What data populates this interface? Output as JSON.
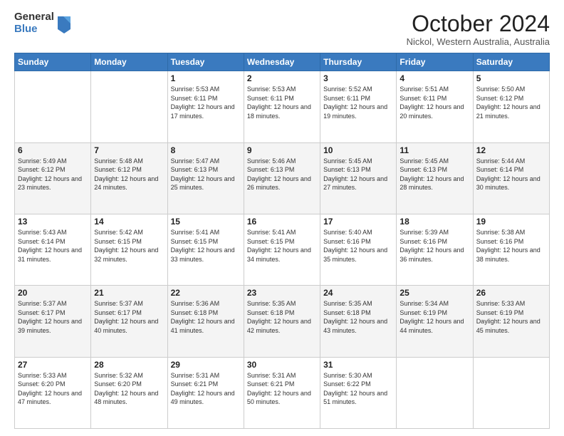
{
  "logo": {
    "general": "General",
    "blue": "Blue"
  },
  "header": {
    "month": "October 2024",
    "location": "Nickol, Western Australia, Australia"
  },
  "weekdays": [
    "Sunday",
    "Monday",
    "Tuesday",
    "Wednesday",
    "Thursday",
    "Friday",
    "Saturday"
  ],
  "weeks": [
    [
      {
        "day": "",
        "info": ""
      },
      {
        "day": "",
        "info": ""
      },
      {
        "day": "1",
        "info": "Sunrise: 5:53 AM\nSunset: 6:11 PM\nDaylight: 12 hours and 17 minutes."
      },
      {
        "day": "2",
        "info": "Sunrise: 5:53 AM\nSunset: 6:11 PM\nDaylight: 12 hours and 18 minutes."
      },
      {
        "day": "3",
        "info": "Sunrise: 5:52 AM\nSunset: 6:11 PM\nDaylight: 12 hours and 19 minutes."
      },
      {
        "day": "4",
        "info": "Sunrise: 5:51 AM\nSunset: 6:11 PM\nDaylight: 12 hours and 20 minutes."
      },
      {
        "day": "5",
        "info": "Sunrise: 5:50 AM\nSunset: 6:12 PM\nDaylight: 12 hours and 21 minutes."
      }
    ],
    [
      {
        "day": "6",
        "info": "Sunrise: 5:49 AM\nSunset: 6:12 PM\nDaylight: 12 hours and 23 minutes."
      },
      {
        "day": "7",
        "info": "Sunrise: 5:48 AM\nSunset: 6:12 PM\nDaylight: 12 hours and 24 minutes."
      },
      {
        "day": "8",
        "info": "Sunrise: 5:47 AM\nSunset: 6:13 PM\nDaylight: 12 hours and 25 minutes."
      },
      {
        "day": "9",
        "info": "Sunrise: 5:46 AM\nSunset: 6:13 PM\nDaylight: 12 hours and 26 minutes."
      },
      {
        "day": "10",
        "info": "Sunrise: 5:45 AM\nSunset: 6:13 PM\nDaylight: 12 hours and 27 minutes."
      },
      {
        "day": "11",
        "info": "Sunrise: 5:45 AM\nSunset: 6:13 PM\nDaylight: 12 hours and 28 minutes."
      },
      {
        "day": "12",
        "info": "Sunrise: 5:44 AM\nSunset: 6:14 PM\nDaylight: 12 hours and 30 minutes."
      }
    ],
    [
      {
        "day": "13",
        "info": "Sunrise: 5:43 AM\nSunset: 6:14 PM\nDaylight: 12 hours and 31 minutes."
      },
      {
        "day": "14",
        "info": "Sunrise: 5:42 AM\nSunset: 6:15 PM\nDaylight: 12 hours and 32 minutes."
      },
      {
        "day": "15",
        "info": "Sunrise: 5:41 AM\nSunset: 6:15 PM\nDaylight: 12 hours and 33 minutes."
      },
      {
        "day": "16",
        "info": "Sunrise: 5:41 AM\nSunset: 6:15 PM\nDaylight: 12 hours and 34 minutes."
      },
      {
        "day": "17",
        "info": "Sunrise: 5:40 AM\nSunset: 6:16 PM\nDaylight: 12 hours and 35 minutes."
      },
      {
        "day": "18",
        "info": "Sunrise: 5:39 AM\nSunset: 6:16 PM\nDaylight: 12 hours and 36 minutes."
      },
      {
        "day": "19",
        "info": "Sunrise: 5:38 AM\nSunset: 6:16 PM\nDaylight: 12 hours and 38 minutes."
      }
    ],
    [
      {
        "day": "20",
        "info": "Sunrise: 5:37 AM\nSunset: 6:17 PM\nDaylight: 12 hours and 39 minutes."
      },
      {
        "day": "21",
        "info": "Sunrise: 5:37 AM\nSunset: 6:17 PM\nDaylight: 12 hours and 40 minutes."
      },
      {
        "day": "22",
        "info": "Sunrise: 5:36 AM\nSunset: 6:18 PM\nDaylight: 12 hours and 41 minutes."
      },
      {
        "day": "23",
        "info": "Sunrise: 5:35 AM\nSunset: 6:18 PM\nDaylight: 12 hours and 42 minutes."
      },
      {
        "day": "24",
        "info": "Sunrise: 5:35 AM\nSunset: 6:18 PM\nDaylight: 12 hours and 43 minutes."
      },
      {
        "day": "25",
        "info": "Sunrise: 5:34 AM\nSunset: 6:19 PM\nDaylight: 12 hours and 44 minutes."
      },
      {
        "day": "26",
        "info": "Sunrise: 5:33 AM\nSunset: 6:19 PM\nDaylight: 12 hours and 45 minutes."
      }
    ],
    [
      {
        "day": "27",
        "info": "Sunrise: 5:33 AM\nSunset: 6:20 PM\nDaylight: 12 hours and 47 minutes."
      },
      {
        "day": "28",
        "info": "Sunrise: 5:32 AM\nSunset: 6:20 PM\nDaylight: 12 hours and 48 minutes."
      },
      {
        "day": "29",
        "info": "Sunrise: 5:31 AM\nSunset: 6:21 PM\nDaylight: 12 hours and 49 minutes."
      },
      {
        "day": "30",
        "info": "Sunrise: 5:31 AM\nSunset: 6:21 PM\nDaylight: 12 hours and 50 minutes."
      },
      {
        "day": "31",
        "info": "Sunrise: 5:30 AM\nSunset: 6:22 PM\nDaylight: 12 hours and 51 minutes."
      },
      {
        "day": "",
        "info": ""
      },
      {
        "day": "",
        "info": ""
      }
    ]
  ]
}
